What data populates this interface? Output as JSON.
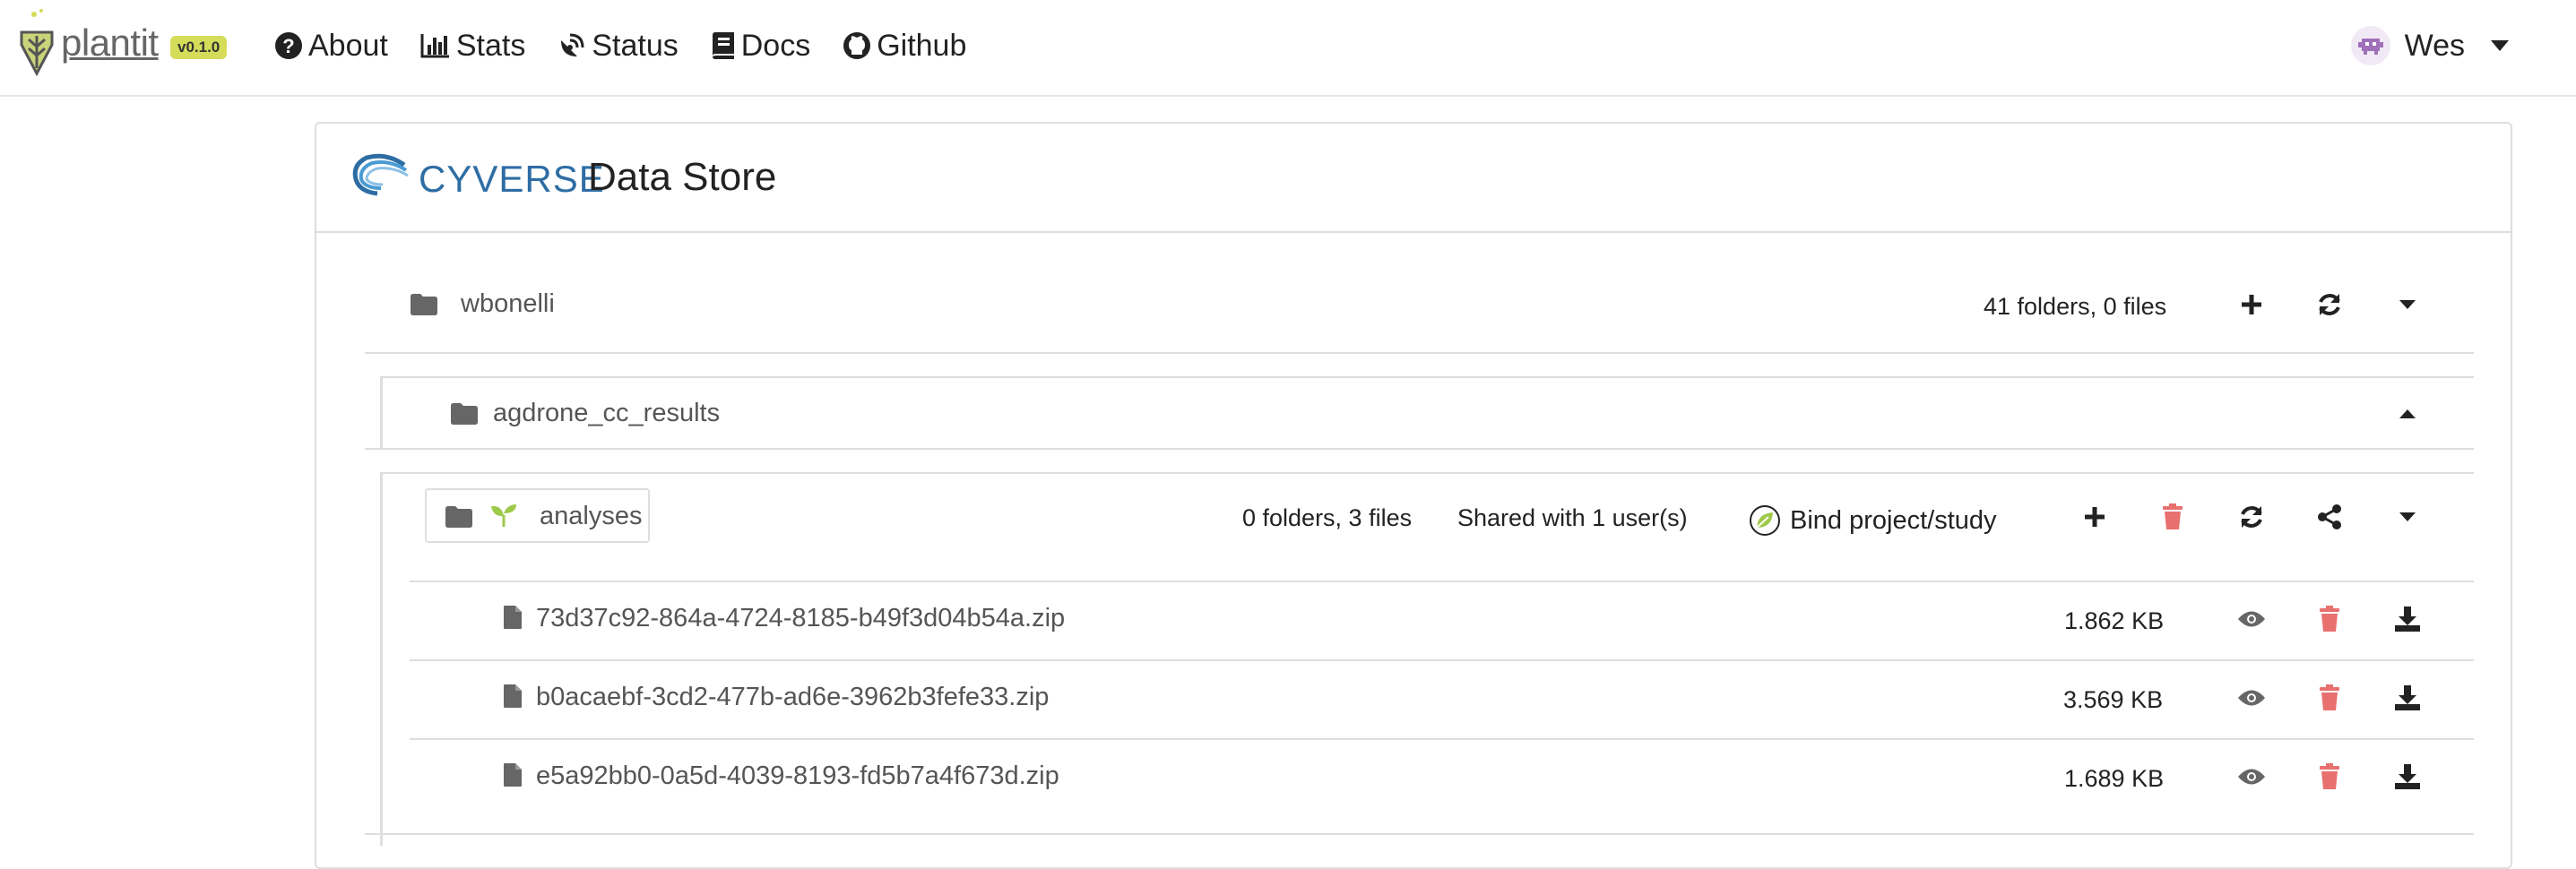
{
  "brand": {
    "name": "plantit",
    "version": "v0.1.0"
  },
  "nav": {
    "links": [
      {
        "label": "About",
        "icon": "question-circle-icon"
      },
      {
        "label": "Stats",
        "icon": "chart-bar-icon"
      },
      {
        "label": "Status",
        "icon": "satellite-dish-icon"
      },
      {
        "label": "Docs",
        "icon": "book-icon"
      },
      {
        "label": "Github",
        "icon": "github-icon"
      }
    ],
    "user": {
      "name": "Wes",
      "avatar_icon": "invader-avatar-icon"
    }
  },
  "datastore": {
    "provider": "CYVERSE",
    "title": "Data Store",
    "root": {
      "name": "wbonelli",
      "summary": "41 folders, 0 files"
    },
    "subfolder": {
      "name": "agdrone_cc_results"
    },
    "analyses": {
      "name": "analyses",
      "summary": "0 folders, 3 files",
      "shared": "Shared with 1 user(s)",
      "bind_label": "Bind project/study"
    },
    "files": [
      {
        "name": "73d37c92-864a-4724-8185-b49f3d04b54a.zip",
        "size": "1.862 KB"
      },
      {
        "name": "b0acaebf-3cd2-477b-ad6e-3962b3fefe33.zip",
        "size": "3.569 KB"
      },
      {
        "name": "e5a92bb0-0a5d-4039-8193-fd5b7a4f673d.zip",
        "size": "1.689 KB"
      }
    ]
  },
  "colors": {
    "delete": "#e8706e",
    "accent_green": "#9ec94a",
    "cyverse_blue": "#2e6da4",
    "icon_dark": "#222222",
    "icon_grey": "#666666"
  }
}
